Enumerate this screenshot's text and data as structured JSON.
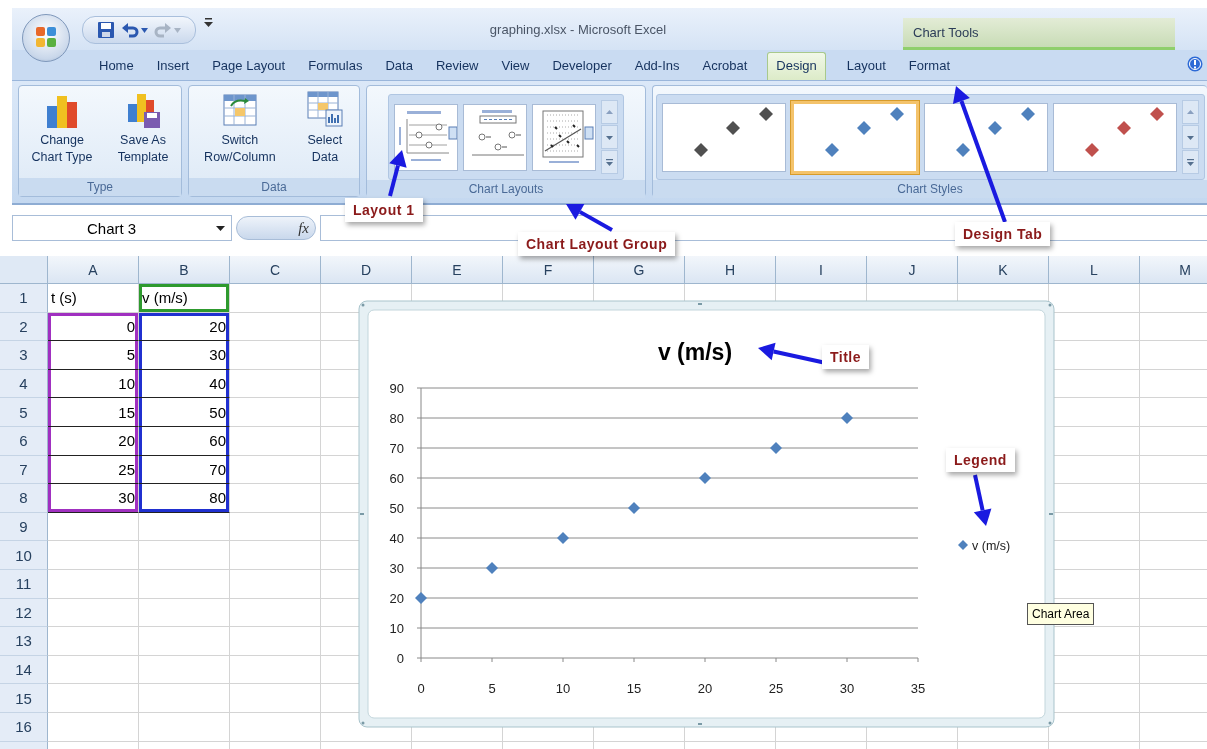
{
  "window": {
    "title": "graphing.xlsx - Microsoft Excel",
    "context_label": "Chart Tools"
  },
  "quick_access": [
    {
      "kind": "save",
      "disabled": false
    },
    {
      "kind": "undo",
      "disabled": false
    },
    {
      "kind": "redo",
      "disabled": true
    }
  ],
  "tabs": [
    {
      "label": "Home",
      "selected": false
    },
    {
      "label": "Insert",
      "selected": false
    },
    {
      "label": "Page Layout",
      "selected": false
    },
    {
      "label": "Formulas",
      "selected": false
    },
    {
      "label": "Data",
      "selected": false
    },
    {
      "label": "Review",
      "selected": false
    },
    {
      "label": "View",
      "selected": false
    },
    {
      "label": "Developer",
      "selected": false
    },
    {
      "label": "Add-Ins",
      "selected": false
    },
    {
      "label": "Acrobat",
      "selected": false
    },
    {
      "label": "Design",
      "selected": true
    },
    {
      "label": "Layout",
      "selected": false
    },
    {
      "label": "Format",
      "selected": false
    }
  ],
  "ribbon": [
    {
      "label": "Type",
      "kind": "buttons",
      "items": [
        {
          "label": "Change\nChart Type"
        },
        {
          "label": "Save As\nTemplate"
        }
      ]
    },
    {
      "label": "Data",
      "kind": "buttons",
      "items": [
        {
          "label": "Switch\nRow/Column"
        },
        {
          "label": "Select\nData"
        }
      ]
    },
    {
      "label": "Chart Layouts",
      "kind": "gallery",
      "items": [
        {
          "selected": false
        },
        {
          "selected": false
        },
        {
          "selected": false
        }
      ]
    },
    {
      "label": "Chart Styles",
      "kind": "gallery",
      "items": [
        {
          "selected": false,
          "color": "#505050"
        },
        {
          "selected": true,
          "color": "#4f81bd"
        },
        {
          "selected": false,
          "color": "#4f81bd"
        },
        {
          "selected": false,
          "color": "#c0504d"
        }
      ]
    }
  ],
  "formula_bar": {
    "name_box": "Chart 3",
    "function_label": "fx"
  },
  "sheet": {
    "columns": [
      "A",
      "B",
      "C",
      "D",
      "E",
      "F",
      "G",
      "H",
      "I",
      "J",
      "K",
      "L",
      "M"
    ],
    "rows": [
      "1",
      "2",
      "3",
      "4",
      "5",
      "6",
      "7",
      "8",
      "9",
      "10",
      "11",
      "12",
      "13",
      "14",
      "15",
      "16"
    ],
    "cells": [
      [
        {
          "text": "t (s)"
        },
        {
          "text": "v (m/s)",
          "color": "#2e9a2e"
        }
      ],
      [
        {
          "text": "0",
          "color": "#a030c0"
        },
        {
          "text": "20",
          "color": "#2030d0"
        }
      ],
      [
        {
          "text": "5",
          "color": "#a030c0"
        },
        {
          "text": "30",
          "color": "#2030d0"
        }
      ],
      [
        {
          "text": "10",
          "color": "#a030c0"
        },
        {
          "text": "40",
          "color": "#2030d0"
        }
      ],
      [
        {
          "text": "15",
          "color": "#a030c0"
        },
        {
          "text": "50",
          "color": "#2030d0"
        }
      ],
      [
        {
          "text": "20",
          "color": "#a030c0"
        },
        {
          "text": "60",
          "color": "#2030d0"
        }
      ],
      [
        {
          "text": "25",
          "color": "#a030c0"
        },
        {
          "text": "70",
          "color": "#2030d0"
        }
      ],
      [
        {
          "text": "30",
          "color": "#a030c0"
        },
        {
          "text": "80",
          "color": "#2030d0"
        }
      ]
    ]
  },
  "chart": {
    "tooltip": "Chart Area",
    "chart_data": {
      "type": "scatter",
      "title": "v (m/s)",
      "x": [
        0,
        5,
        10,
        15,
        20,
        25,
        30
      ],
      "series": [
        {
          "name": "v (m/s)",
          "color": "#4f81bd",
          "values": [
            20,
            30,
            40,
            50,
            60,
            70,
            80
          ]
        }
      ],
      "xlim": [
        0,
        35
      ],
      "ylim": [
        0,
        90
      ],
      "grid": true,
      "xticks": [
        0,
        5,
        10,
        15,
        20,
        25,
        30,
        35
      ],
      "yticks": [
        0,
        10,
        20,
        30,
        40,
        50,
        60,
        70,
        80,
        90
      ]
    }
  },
  "annotations": [
    {
      "text": "Layout 1"
    },
    {
      "text": "Chart Layout Group"
    },
    {
      "text": "Design Tab"
    },
    {
      "text": "Title"
    },
    {
      "text": "Legend"
    }
  ]
}
